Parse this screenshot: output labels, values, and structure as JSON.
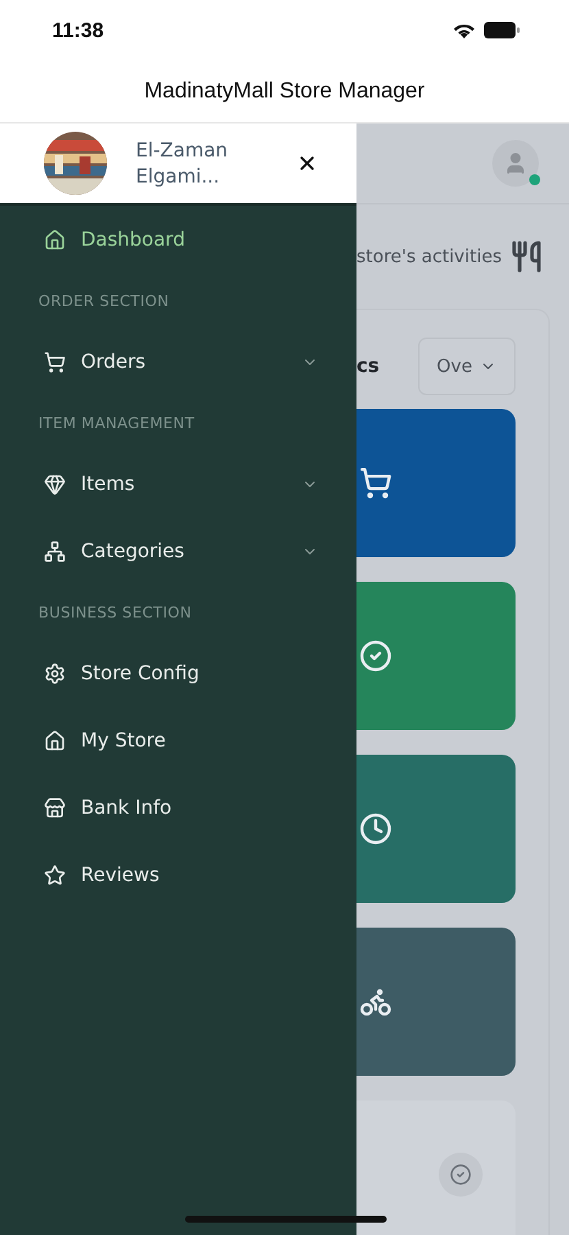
{
  "status_bar": {
    "time": "11:38"
  },
  "app_bar": {
    "title": "MadinatyMall Store Manager"
  },
  "drawer": {
    "profile": {
      "name_line_1": "El-Zaman",
      "name_line_2": "Elgami..."
    },
    "menu": [
      {
        "kind": "link",
        "label": "Dashboard",
        "selected": true
      },
      {
        "kind": "section",
        "label": "ORDER SECTION"
      },
      {
        "kind": "group",
        "label": "Orders",
        "selected": false
      },
      {
        "kind": "section",
        "label": "ITEM MANAGEMENT"
      },
      {
        "kind": "group",
        "label": "Items",
        "selected": false
      },
      {
        "kind": "group",
        "label": "Categories",
        "selected": false
      },
      {
        "kind": "section",
        "label": "BUSINESS SECTION"
      },
      {
        "kind": "link",
        "label": "Store Config",
        "selected": false
      },
      {
        "kind": "link",
        "label": "My Store",
        "selected": false
      },
      {
        "kind": "link",
        "label": "Bank Info",
        "selected": false
      },
      {
        "kind": "link",
        "label": "Reviews",
        "selected": false
      }
    ]
  },
  "background": {
    "subtitle": "store's activities",
    "stats": {
      "title": "cs",
      "dropdown": "Ove"
    },
    "tiles": [
      {
        "color": "#0d5496"
      },
      {
        "color": "#25855b"
      },
      {
        "color": "#276e66"
      },
      {
        "color": "#3e5c65"
      },
      {
        "color": "#cfd3d9"
      }
    ]
  }
}
